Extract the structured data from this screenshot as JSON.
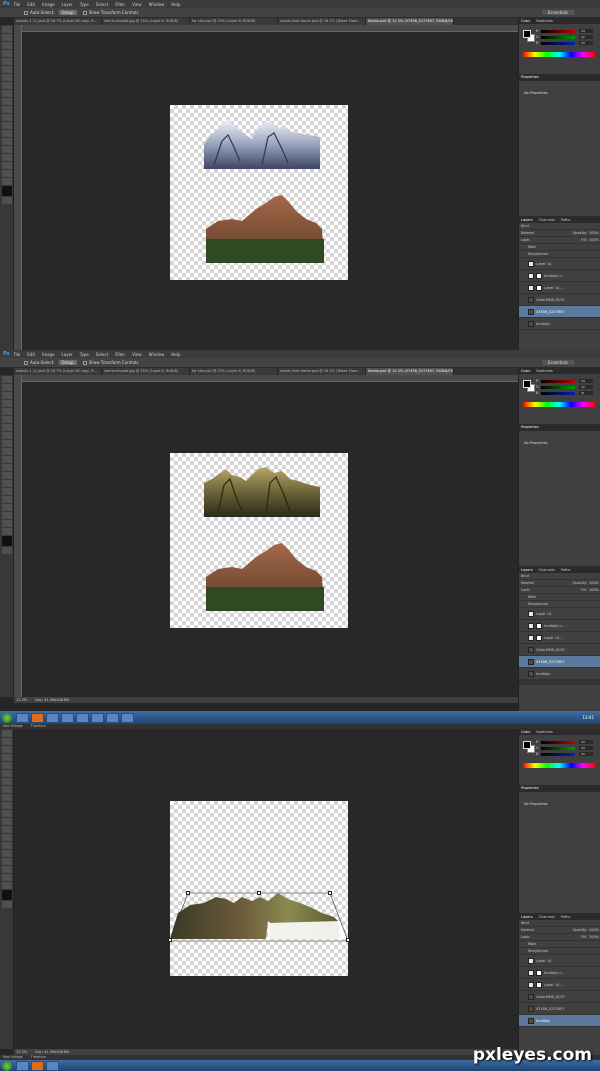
{
  "app": {
    "logo": "Ps",
    "menu": [
      "File",
      "Edit",
      "Image",
      "Layer",
      "Type",
      "Select",
      "Filter",
      "View",
      "Window",
      "Help"
    ],
    "options": {
      "auto_select": "Auto-Select:",
      "auto_select_value": "Group",
      "show_transform": "Show Transform Controls",
      "workspace": "Essentials"
    },
    "tabs": [
      "islands 1 (1).psd @ 16.7% (Layer 58 copy, R...",
      "sierra-nevada.jpg @ 25% (Layer 6, RGB/8)",
      "for site.psd @ 25% (Layer 6, RGB/8)",
      "island-river-home.psd @ 16.7% (Tower Floor...",
      "fotolia.psd @ 12.5% (47456_5237607, RGB/8/CMYK)"
    ]
  },
  "panels": {
    "color_tab": "Color",
    "swatches_tab": "Swatches",
    "channels": [
      "R",
      "G",
      "B"
    ],
    "panel1_values": [
      "34",
      "32",
      "33"
    ],
    "panel2_values": [
      "34",
      "32",
      "31"
    ],
    "panel3_values": [
      "33",
      "34",
      "30"
    ],
    "properties_tab": "Properties",
    "no_properties": "No Properties",
    "layers_tabs": [
      "Layers",
      "Channels",
      "Paths"
    ],
    "kind": "Kind",
    "blend_mode": "Normal",
    "opacity_label": "Opacity:",
    "opacity_value": "100%",
    "lock_label": "Lock:",
    "fill_label": "Fill:",
    "fill_value": "100%",
    "layers_1": [
      "Main",
      "Storyleuren",
      "Layer 14",
      "multiply c...",
      "Layer 14 ...",
      "Gallo MNS_6130",
      "47456_5237607",
      "multiply"
    ],
    "layers_2": [
      "Main",
      "Storyleuren",
      "Layer 14",
      "multiply c...",
      "Layer 14 ...",
      "Gallo MNS_6130",
      "47456_5237607",
      "multiply"
    ],
    "layers_3": [
      "Main",
      "Storyleuren",
      "Layer 14",
      "multiply c...",
      "Layer 14 ...",
      "Gallo MNS_6130",
      "47456_5237607",
      "multiply"
    ]
  },
  "status": {
    "zoom": "12.5%",
    "doc": "Doc: 41.4M/268.8M"
  },
  "taskbar": {
    "time": "13:41"
  },
  "mini_bridge": [
    "Mini Bridge",
    "Timeline"
  ],
  "watermark": "pxleyes.com"
}
